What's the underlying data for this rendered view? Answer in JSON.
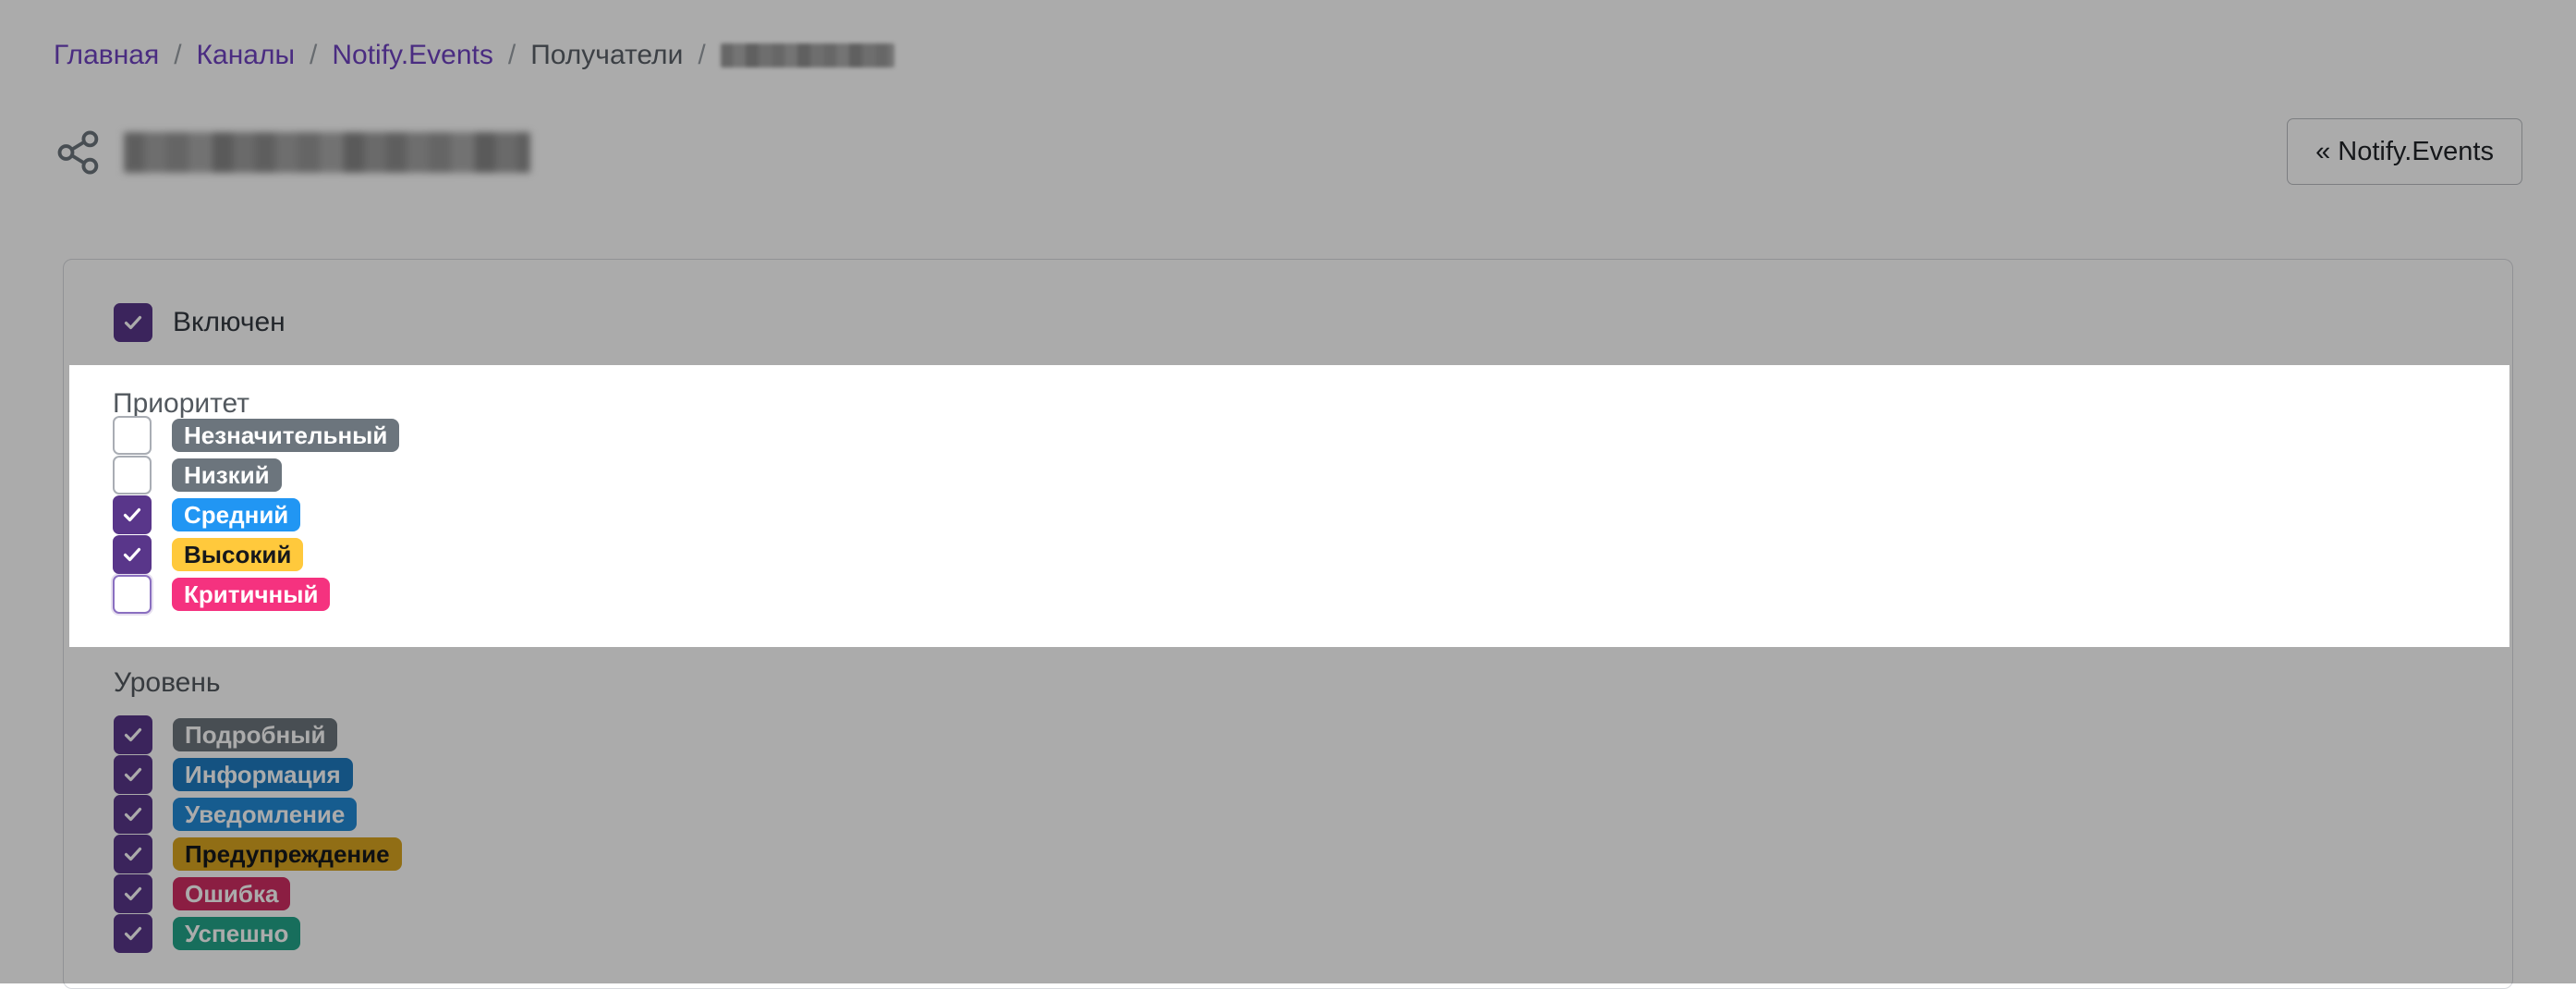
{
  "breadcrumb": {
    "items": [
      {
        "label": "Главная",
        "type": "link"
      },
      {
        "label": "Каналы",
        "type": "link"
      },
      {
        "label": "Notify.Events",
        "type": "link"
      },
      {
        "label": "Получатели",
        "type": "static"
      },
      {
        "label": "",
        "type": "redacted"
      }
    ],
    "separator": "/"
  },
  "header": {
    "icon": "share-nodes-icon",
    "title_redacted": true,
    "back_button": {
      "label": "« Notify.Events",
      "chevron": "«"
    }
  },
  "card": {
    "enabled": {
      "label": "Включен",
      "checked": true
    },
    "priority": {
      "title": "Приоритет",
      "options": [
        {
          "label": "Незначительный",
          "checked": false,
          "color": "#6c757d",
          "text_color": "#ffffff",
          "focused": false
        },
        {
          "label": "Низкий",
          "checked": false,
          "color": "#6c757d",
          "text_color": "#ffffff",
          "focused": false
        },
        {
          "label": "Средний",
          "checked": true,
          "color": "#2196f3",
          "text_color": "#ffffff",
          "focused": false
        },
        {
          "label": "Высокий",
          "checked": true,
          "color": "#ffc93c",
          "text_color": "#16181b",
          "focused": false
        },
        {
          "label": "Критичный",
          "checked": false,
          "color": "#f5327f",
          "text_color": "#ffffff",
          "focused": true
        }
      ]
    },
    "level": {
      "title": "Уровень",
      "options": [
        {
          "label": "Подробный",
          "checked": true,
          "color": "#6c757d",
          "text_color": "#ffffff"
        },
        {
          "label": "Информация",
          "checked": true,
          "color": "#1f7bc1",
          "text_color": "#ffffff"
        },
        {
          "label": "Уведомление",
          "checked": true,
          "color": "#2189d6",
          "text_color": "#ffffff"
        },
        {
          "label": "Предупреждение",
          "checked": true,
          "color": "#d9a520",
          "text_color": "#16181b"
        },
        {
          "label": "Ошибка",
          "checked": true,
          "color": "#cf2e63",
          "text_color": "#ffffff"
        },
        {
          "label": "Успешно",
          "checked": true,
          "color": "#23a48a",
          "text_color": "#ffffff"
        }
      ]
    }
  },
  "theme": {
    "accent_purple": "#59368a",
    "link_purple": "#6f42c1",
    "card_border": "#d8dade",
    "dim_overlay": "rgba(0,0,0,0.33)"
  }
}
